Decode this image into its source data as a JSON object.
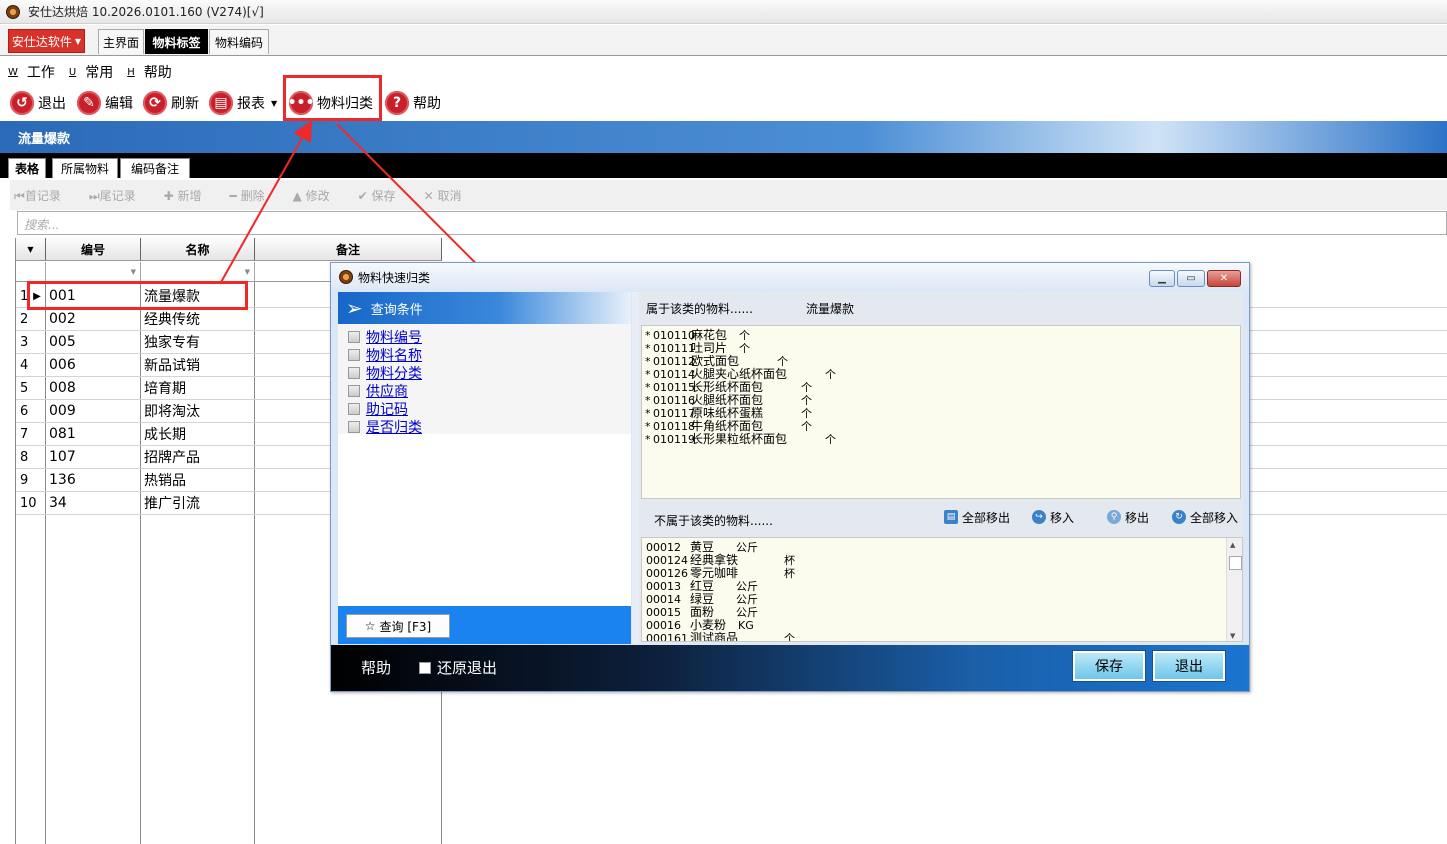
{
  "window": {
    "title": "安仕达烘焙   10.2026.0101.160  (V274)[√]"
  },
  "brand_menu": {
    "label": "安仕达软件"
  },
  "page_tabs": [
    "主界面",
    "物料标签",
    "物料编码"
  ],
  "menu": [
    {
      "key": "W",
      "label": "工作"
    },
    {
      "key": "U",
      "label": "常用"
    },
    {
      "key": "H",
      "label": "帮助"
    }
  ],
  "toolbar": {
    "exit": "退出",
    "edit": "编辑",
    "refresh": "刷新",
    "report": "报表",
    "classify": "物料归类",
    "help": "帮助"
  },
  "section_title": "流量爆款",
  "inner_tabs": [
    "表格",
    "所属物料",
    "编码备注"
  ],
  "record_nav": [
    "首记录",
    "尾记录",
    "新增",
    "删除",
    "修改",
    "保存",
    "取消"
  ],
  "search": {
    "placeholder": "搜索..."
  },
  "grid": {
    "columns": [
      "编号",
      "名称",
      "备注"
    ],
    "rows": [
      {
        "n": "1",
        "code": "001",
        "name": "流量爆款"
      },
      {
        "n": "2",
        "code": "002",
        "name": "经典传统"
      },
      {
        "n": "3",
        "code": "005",
        "name": "独家专有"
      },
      {
        "n": "4",
        "code": "006",
        "name": "新品试销"
      },
      {
        "n": "5",
        "code": "008",
        "name": "培育期"
      },
      {
        "n": "6",
        "code": "009",
        "name": "即将淘汰"
      },
      {
        "n": "7",
        "code": "081",
        "name": "成长期"
      },
      {
        "n": "8",
        "code": "107",
        "name": "招牌产品"
      },
      {
        "n": "9",
        "code": "136",
        "name": "热销品"
      },
      {
        "n": "10",
        "code": "34",
        "name": "推广引流"
      }
    ]
  },
  "dialog": {
    "title": "物料快速归类",
    "query_header": "查询条件",
    "conditions": [
      "物料编号",
      "物料名称",
      "物料分类",
      "供应商",
      "助记码",
      "是否归类"
    ],
    "query_button": "查询 [F3]",
    "belong_label": "属于该类的物料......",
    "belong_category": "流量爆款",
    "belong_items": [
      {
        "mark": "*",
        "code": "010110",
        "name": "麻花包",
        "unit": "个"
      },
      {
        "mark": "*",
        "code": "010111",
        "name": "吐司片",
        "unit": "个"
      },
      {
        "mark": "*",
        "code": "010112",
        "name": "欧式面包",
        "unit": "个"
      },
      {
        "mark": "*",
        "code": "010114",
        "name": "火腿夹心纸杯面包",
        "unit": "个"
      },
      {
        "mark": "*",
        "code": "010115",
        "name": "长形纸杯面包",
        "unit": "个"
      },
      {
        "mark": "*",
        "code": "010116",
        "name": "火腿纸杯面包",
        "unit": "个"
      },
      {
        "mark": "*",
        "code": "010117",
        "name": "原味纸杯蛋糕",
        "unit": "个"
      },
      {
        "mark": "*",
        "code": "010118",
        "name": "牛角纸杯面包",
        "unit": "个"
      },
      {
        "mark": "*",
        "code": "010119",
        "name": "长形果粒纸杯面包",
        "unit": "个"
      }
    ],
    "notbelong_label": "不属于该类的物料......",
    "actions": {
      "remove_all": "全部移出",
      "move_in": "移入",
      "move_out": "移出",
      "move_all_in": "全部移入"
    },
    "notbelong_items": [
      {
        "code": "00012",
        "name": "黄豆",
        "unit": "公斤"
      },
      {
        "code": "000124",
        "name": "经典拿铁",
        "unit": "杯"
      },
      {
        "code": "000126",
        "name": "零元咖啡",
        "unit": "杯"
      },
      {
        "code": "00013",
        "name": "红豆",
        "unit": "公斤"
      },
      {
        "code": "00014",
        "name": "绿豆",
        "unit": "公斤"
      },
      {
        "code": "00015",
        "name": "面粉",
        "unit": "公斤"
      },
      {
        "code": "00016",
        "name": "小麦粉",
        "unit": "KG"
      },
      {
        "code": "000161",
        "name": "测试商品",
        "unit": "个"
      }
    ],
    "footer": {
      "help": "帮助",
      "restore_exit": "还原退出",
      "save": "保存",
      "exit": "退出"
    }
  },
  "colors": {
    "accent_red": "#f02828",
    "brand_red": "#d9322a",
    "header_blue": "#2a6ab8"
  }
}
